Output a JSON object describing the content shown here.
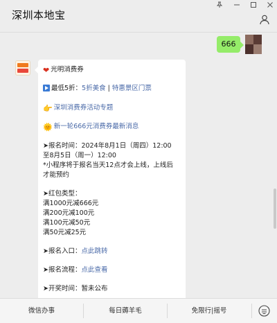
{
  "window": {
    "title": "深圳本地宝"
  },
  "chat": {
    "outgoing_message": "666",
    "incoming": {
      "header": "光明消费券",
      "discount_prefix": "最低5折：",
      "discount_link1": "5折美食",
      "discount_sep": " | ",
      "discount_link2": "特惠景区门票",
      "topic_link": "深圳消费券活动专题",
      "news_link": "新一轮666元消费券最新消息",
      "signup_time_label": "➤报名时间：2024年8月1日（周四）12:00",
      "signup_time_end": "至8月5日（周一）12:00",
      "note_line1": "*小程序将于报名当天12点才会上线，上线后",
      "note_line2": "才能预约",
      "type_label": "➤红包类型：",
      "types": [
        "满1000元减666元",
        "满200元减100元",
        "满100元减50元",
        "满50元减25元"
      ],
      "entry_label": "➤报名入口：",
      "entry_link": "点此跳转",
      "process_label": "➤报名流程：",
      "process_link": "点此查看",
      "draw_label": "➤开奖时间：",
      "draw_value": "暂未公布"
    }
  },
  "bottom_menu": [
    "微信办事",
    "每日薅羊毛",
    "免限行|摇号"
  ],
  "icons": {
    "heart": "heart-icon",
    "play": "play-icon",
    "point": "pointing-hand-icon",
    "sun": "sun-icon"
  },
  "colors": {
    "link": "#4a6aa8",
    "outgoing_bubble": "#95ec69"
  }
}
